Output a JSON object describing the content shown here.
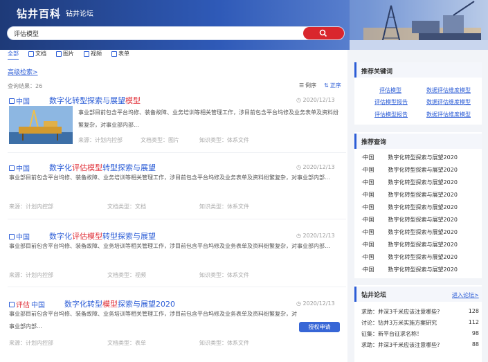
{
  "header": {
    "brand": "钻井百科",
    "forum_link": "钻井论坛"
  },
  "search": {
    "value": "评估模型"
  },
  "tabs": [
    {
      "label": "全部",
      "active": true
    },
    {
      "label": "文档",
      "icon": "document-icon"
    },
    {
      "label": "图片",
      "icon": "image-icon"
    },
    {
      "label": "视频",
      "icon": "video-icon"
    },
    {
      "label": "表单",
      "icon": "form-icon"
    }
  ],
  "advanced_search": "高级检索>",
  "result_count": "查询结果：26",
  "sort": {
    "desc": "倒序",
    "asc": "正序"
  },
  "results": [
    {
      "prefix": "中国",
      "title_pre": "数字化转型探索与展望",
      "title_hl": "模型",
      "title_post": "",
      "date": "2020/12/13",
      "desc": "事业部目前包含平台坞修、装备故障、业务培训等相关管理工作，涉目前包含平台坞修及业务表单及资料纷繁复杂，对事业部内部...",
      "source": "来源：计划内控部",
      "doc_type": "文档类型：图片",
      "knowledge_type": "知识类型：体系文件"
    },
    {
      "prefix": "中国",
      "title_pre": "数字化",
      "title_hl": "评估模型",
      "title_post": "转型探索与展望",
      "date": "2020/12/13",
      "desc": "事业部目前包含平台坞修、装备故障、业务培训等相关管理工作，涉目前包含平台坞修及业务表单及资料纷繁复杂，对事业部内部...",
      "source": "来源：计划内控部",
      "doc_type": "文档类型：文档",
      "knowledge_type": "知识类型：体系文件"
    },
    {
      "prefix": "中国",
      "title_pre": "数字化",
      "title_hl": "评估模型",
      "title_post": "转型探索与展望",
      "date": "2020/12/13",
      "desc": "事业部目前包含平台坞修、装备故障、业务培训等相关管理工作，涉目前包含平台坞修及业务表单及资料纷繁复杂，对事业部内部...",
      "source": "来源：计划内控部",
      "doc_type": "文档类型：视频",
      "knowledge_type": "知识类型：体系文件"
    },
    {
      "prefix_hl": "评估",
      "prefix": "中国",
      "title_pre": "数字化转型",
      "title_hl": "模型",
      "title_post": "探索与展望2020",
      "date": "2020/12/13",
      "desc": "事业部目前包含平台坞修、装备故障、业务培训等相关管理工作，涉目前包含平台坞修及业务表单及资料纷繁复杂，对事业部内部...",
      "source": "来源：计划内控部",
      "doc_type": "文档类型：表单",
      "knowledge_type": "知识类型：体系文件",
      "apply_button": "授权申请"
    }
  ],
  "keywords": {
    "title": "推荐关键词",
    "items": [
      "评估模型",
      "数据评估维度模型",
      "评估模型报告",
      "数据评估维度模型",
      "评估模型报告",
      "数据评估维度模型"
    ]
  },
  "recommend": {
    "title": "推荐查询",
    "items": [
      {
        "prefix": "中国",
        "text": "数字化转型探索与展望2020"
      },
      {
        "prefix": "中国",
        "text": "数字化转型探索与展望2020"
      },
      {
        "prefix": "中国",
        "text": "数字化转型探索与展望2020"
      },
      {
        "prefix": "中国",
        "text": "数字化转型探索与展望2020"
      },
      {
        "prefix": "中国",
        "text": "数字化转型探索与展望2020"
      },
      {
        "prefix": "中国",
        "text": "数字化转型探索与展望2020"
      },
      {
        "prefix": "中国",
        "text": "数字化转型探索与展望2020"
      },
      {
        "prefix": "中国",
        "text": "数字化转型探索与展望2020"
      },
      {
        "prefix": "中国",
        "text": "数字化转型探索与展望2020"
      },
      {
        "prefix": "中国",
        "text": "数字化转型探索与展望2020"
      }
    ]
  },
  "forum": {
    "title": "钻井论坛",
    "enter": "进入论坛>",
    "items": [
      {
        "text": "求助：井深3千米应该注意哪些?",
        "count": "128"
      },
      {
        "text": "讨论：钻井3万米实施方案研究",
        "count": "112"
      },
      {
        "text": "征集：新平台征求名称！",
        "count": "98"
      },
      {
        "text": "求助：井深3千米应该注意哪些?",
        "count": "88"
      }
    ]
  }
}
